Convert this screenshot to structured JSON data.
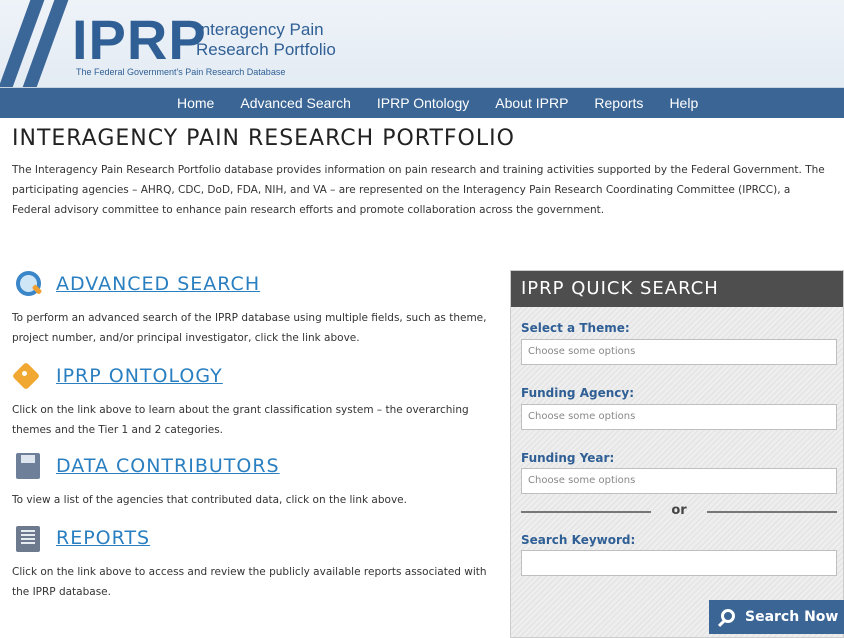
{
  "header": {
    "logo": "IPRP",
    "logo_subtitle": "Interagency Pain Research Portfolio",
    "tagline": "The Federal Government's Pain Research Database"
  },
  "nav": {
    "items": [
      "Home",
      "Advanced Search",
      "IPRP Ontology",
      "About IPRP",
      "Reports",
      "Help"
    ]
  },
  "main": {
    "title": "INTERAGENCY PAIN RESEARCH PORTFOLIO",
    "intro": "The Interagency Pain Research Portfolio database provides information on pain research and training activities supported by the Federal Government. The participating agencies – AHRQ, CDC, DoD, FDA, NIH, and VA – are represented on the Interagency Pain Research Coordinating Committee (IPRCC), a Federal advisory committee to enhance pain research efforts and promote collaboration across the government.",
    "sections": [
      {
        "icon": "magnifier-icon",
        "link": "ADVANCED SEARCH",
        "desc": "To perform an advanced search of the IPRP database using multiple fields, such as theme, project number, and/or principal investigator, click the link above."
      },
      {
        "icon": "tag-icon",
        "link": "IPRP ONTOLOGY",
        "desc": "Click on the link above to learn about the grant classification system – the overarching themes and the Tier 1 and 2 categories."
      },
      {
        "icon": "floppy-disk-icon",
        "link": "DATA CONTRIBUTORS",
        "desc": "To view a list of the agencies that contributed data, click on the link above."
      },
      {
        "icon": "report-icon",
        "link": "REPORTS",
        "desc": "Click on the link above to access and review the publicly available reports associated with the IPRP database."
      }
    ]
  },
  "quick_search": {
    "title": "IPRP QUICK SEARCH",
    "theme_label": "Select a Theme:",
    "theme_placeholder": "Choose some options",
    "agency_label": "Funding Agency:",
    "agency_placeholder": "Choose some options",
    "year_label": "Funding Year:",
    "year_placeholder": "Choose some options",
    "or_text": "or",
    "keyword_label": "Search Keyword:",
    "keyword_value": "",
    "button_label": "Search Now"
  }
}
